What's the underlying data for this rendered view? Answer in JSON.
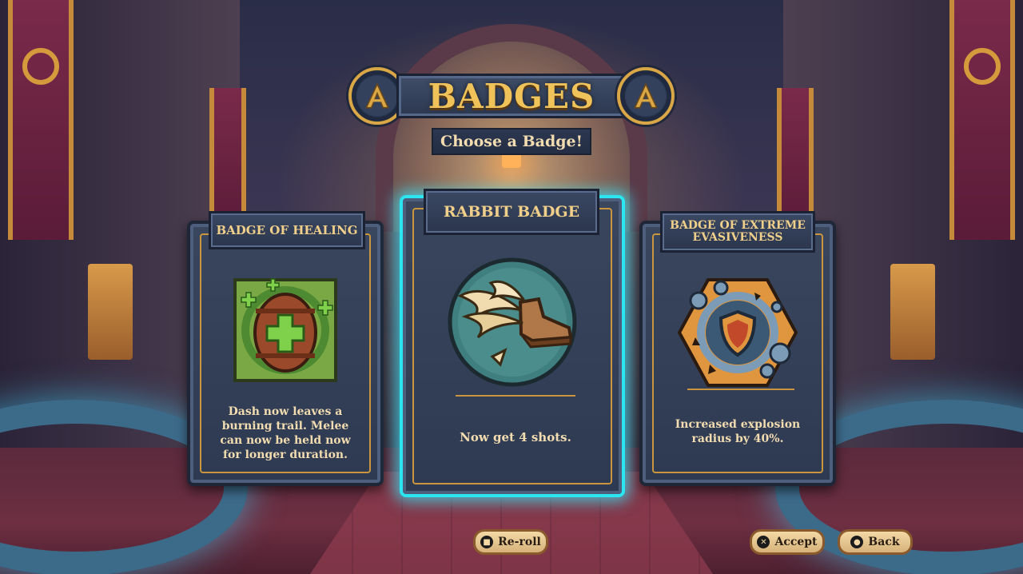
{
  "header": {
    "title": "BADGES",
    "subtitle": "Choose a Badge!"
  },
  "cards": [
    {
      "title": "BADGE OF HEALING",
      "description": "Dash now leaves a burning trail. Melee can now be held now for longer duration.",
      "icon": "healing-barrel-icon",
      "selected": false
    },
    {
      "title": "RABBIT BADGE",
      "description": "Now get 4 shots.",
      "icon": "winged-boot-icon",
      "selected": true
    },
    {
      "title": "BADGE OF EXTREME EVASIVENESS",
      "description": "Increased explosion radius by 40%.",
      "icon": "shield-hexagon-icon",
      "selected": false
    }
  ],
  "buttons": {
    "reroll": {
      "label": "Re-roll",
      "glyph": "square-button-icon"
    },
    "accept": {
      "label": "Accept",
      "glyph": "cross-button-icon"
    },
    "back": {
      "label": "Back",
      "glyph": "circle-button-icon"
    }
  },
  "colors": {
    "gold": "#f0c25a",
    "card": "#39465e",
    "highlight": "#2be6f0",
    "button": "#f3d9a6"
  }
}
